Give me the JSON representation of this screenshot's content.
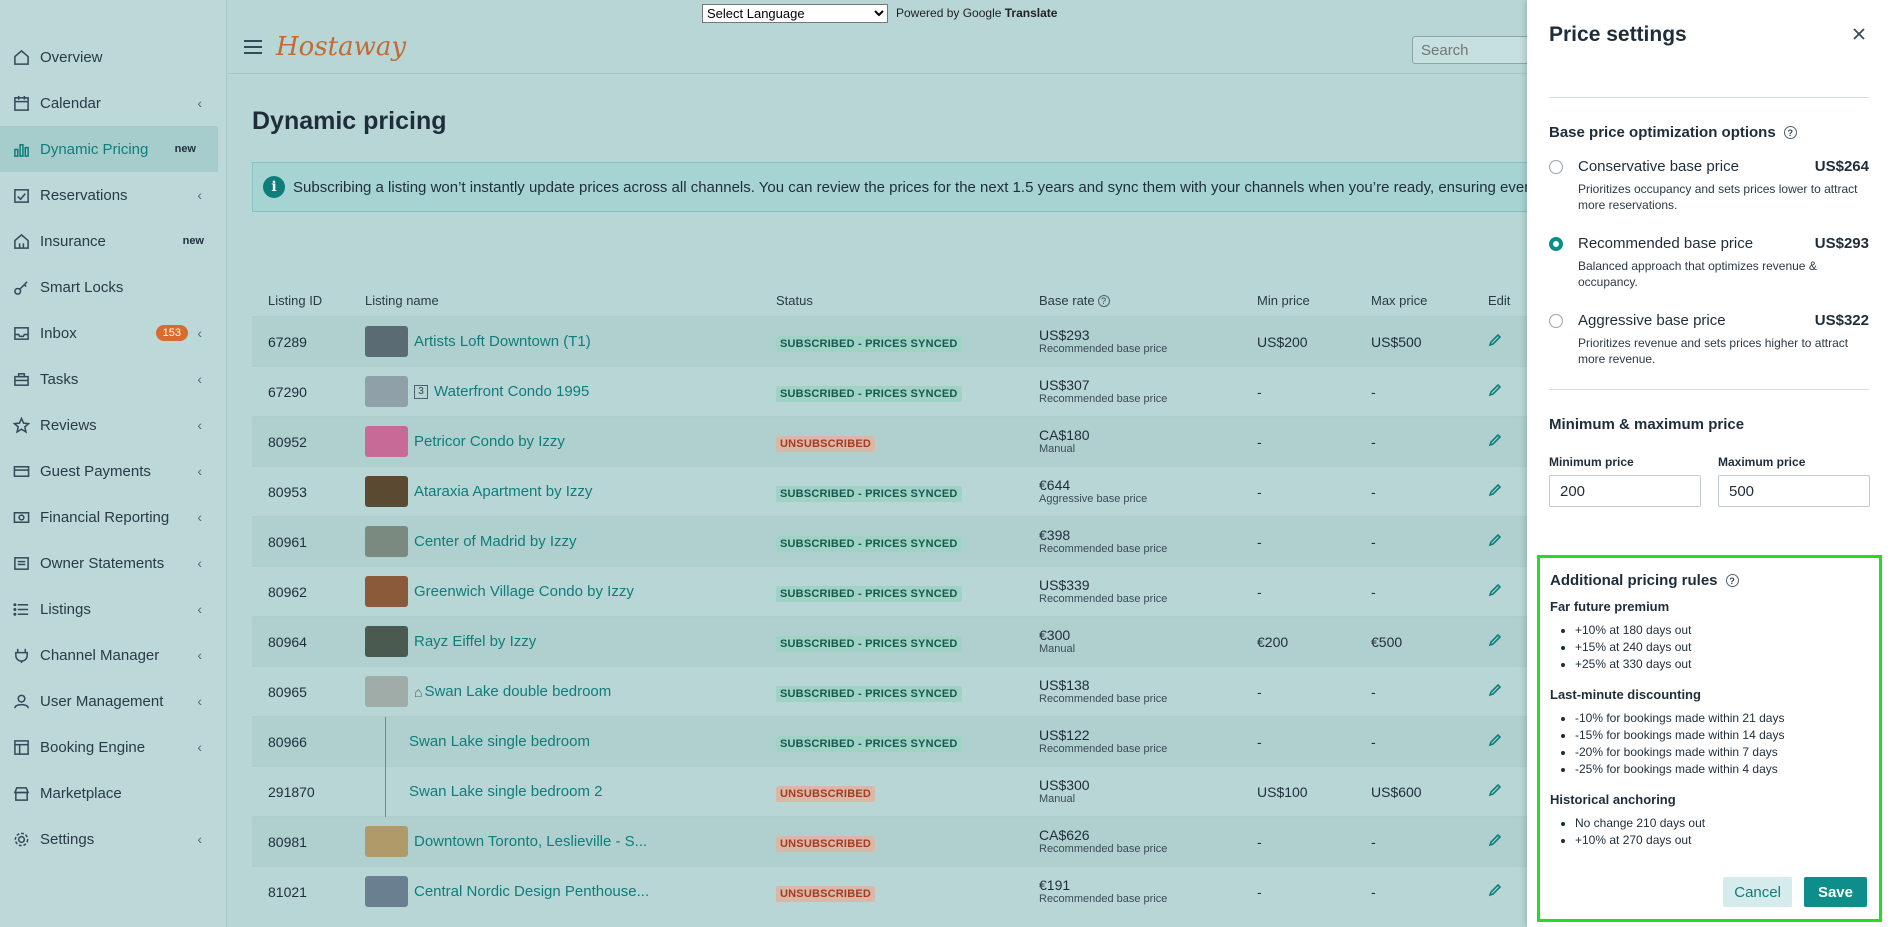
{
  "translate": {
    "select_value": "Select Language",
    "powered_by": "Powered by",
    "google": "Google",
    "translate": "Translate"
  },
  "sidebar": {
    "items": [
      {
        "label": "Overview",
        "icon": "home-icon"
      },
      {
        "label": "Calendar",
        "icon": "calendar-icon",
        "chevron": "‹"
      },
      {
        "label": "Dynamic Pricing",
        "icon": "bar-chart-icon",
        "badge": "new"
      },
      {
        "label": "Reservations",
        "icon": "calendar-check-icon",
        "chevron": "‹"
      },
      {
        "label": "Insurance",
        "icon": "house-shield-icon",
        "badge": "new"
      },
      {
        "label": "Smart Locks",
        "icon": "key-icon"
      },
      {
        "label": "Inbox",
        "icon": "inbox-icon",
        "count": "153",
        "chevron": "‹"
      },
      {
        "label": "Tasks",
        "icon": "toolbox-icon",
        "chevron": "‹"
      },
      {
        "label": "Reviews",
        "icon": "star-icon",
        "chevron": "‹"
      },
      {
        "label": "Guest Payments",
        "icon": "credit-card-icon",
        "chevron": "‹"
      },
      {
        "label": "Financial Reporting",
        "icon": "money-icon",
        "chevron": "‹"
      },
      {
        "label": "Owner Statements",
        "icon": "statement-icon",
        "chevron": "‹"
      },
      {
        "label": "Listings",
        "icon": "list-icon",
        "chevron": "‹"
      },
      {
        "label": "Channel Manager",
        "icon": "plug-icon",
        "chevron": "‹"
      },
      {
        "label": "User Management",
        "icon": "user-icon",
        "chevron": "‹"
      },
      {
        "label": "Booking Engine",
        "icon": "layout-icon",
        "chevron": "‹"
      },
      {
        "label": "Marketplace",
        "icon": "store-icon"
      },
      {
        "label": "Settings",
        "icon": "gear-icon",
        "chevron": "‹"
      }
    ]
  },
  "header": {
    "logo": "Hostaway",
    "search_placeholder": "Search"
  },
  "main": {
    "title": "Dynamic pricing",
    "banner": "Subscribing a listing won’t instantly update prices across all channels. You can review the prices for the next 1.5 years and sync them with your channels when you’re ready, ensuring everythin",
    "columns": {
      "id": "Listing ID",
      "name": "Listing name",
      "status": "Status",
      "base": "Base rate",
      "min": "Min price",
      "max": "Max price",
      "edit": "Edit"
    }
  },
  "rows": [
    {
      "id": "67289",
      "name": "Artists Loft Downtown (T1)",
      "status": "SUBSCRIBED - PRICES SYNCED",
      "sub": true,
      "base": "US$293",
      "base_sub": "Recommended base price",
      "min": "US$200",
      "max": "US$500",
      "thumb": "#5a6b74"
    },
    {
      "id": "67290",
      "name": "Waterfront Condo 1995",
      "unit": "3",
      "status": "SUBSCRIBED - PRICES SYNCED",
      "sub": true,
      "base": "US$307",
      "base_sub": "Recommended base price",
      "min": "-",
      "max": "-",
      "thumb": "#8fa0a8"
    },
    {
      "id": "80952",
      "name": "Petricor Condo by Izzy",
      "status": "UNSUBSCRIBED",
      "sub": false,
      "base": "CA$180",
      "base_sub": "Manual",
      "min": "-",
      "max": "-",
      "thumb": "#c86a98"
    },
    {
      "id": "80953",
      "name": "Ataraxia Apartment by Izzy",
      "status": "SUBSCRIBED - PRICES SYNCED",
      "sub": true,
      "base": "€644",
      "base_sub": "Aggressive base price",
      "min": "-",
      "max": "-",
      "thumb": "#5a4a32"
    },
    {
      "id": "80961",
      "name": "Center of Madrid by Izzy",
      "status": "SUBSCRIBED - PRICES SYNCED",
      "sub": true,
      "base": "€398",
      "base_sub": "Recommended base price",
      "min": "-",
      "max": "-",
      "thumb": "#7a8a80"
    },
    {
      "id": "80962",
      "name": "Greenwich Village Condo by Izzy",
      "status": "SUBSCRIBED - PRICES SYNCED",
      "sub": true,
      "base": "US$339",
      "base_sub": "Recommended base price",
      "min": "-",
      "max": "-",
      "thumb": "#8a5a3a"
    },
    {
      "id": "80964",
      "name": "Rayz Eiffel by Izzy",
      "status": "SUBSCRIBED - PRICES SYNCED",
      "sub": true,
      "base": "€300",
      "base_sub": "Manual",
      "min": "€200",
      "max": "€500",
      "thumb": "#4a5a50"
    },
    {
      "id": "80965",
      "name": "Swan Lake double bedroom",
      "parent": true,
      "status": "SUBSCRIBED - PRICES SYNCED",
      "sub": true,
      "base": "US$138",
      "base_sub": "Recommended base price",
      "min": "-",
      "max": "-",
      "thumb": "#a0aca8"
    },
    {
      "id": "80966",
      "name": "Swan Lake single bedroom",
      "child": true,
      "status": "SUBSCRIBED - PRICES SYNCED",
      "sub": true,
      "base": "US$122",
      "base_sub": "Recommended base price",
      "min": "-",
      "max": "-"
    },
    {
      "id": "291870",
      "name": "Swan Lake single bedroom 2",
      "child": true,
      "status": "UNSUBSCRIBED",
      "sub": false,
      "base": "US$300",
      "base_sub": "Manual",
      "min": "US$100",
      "max": "US$600"
    },
    {
      "id": "80981",
      "name": "Downtown Toronto, Leslieville - S...",
      "status": "UNSUBSCRIBED",
      "sub": false,
      "base": "CA$626",
      "base_sub": "Recommended base price",
      "min": "-",
      "max": "-",
      "thumb": "#b09a6a"
    },
    {
      "id": "81021",
      "name": "Central Nordic Design Penthouse...",
      "status": "UNSUBSCRIBED",
      "sub": false,
      "base": "€191",
      "base_sub": "Recommended base price",
      "min": "-",
      "max": "-",
      "thumb": "#6a8090"
    }
  ],
  "panel": {
    "title": "Price settings",
    "base_section": "Base price optimization options",
    "options": [
      {
        "label": "Conservative base price",
        "price": "US$264",
        "desc": "Prioritizes occupancy and sets prices lower to attract more reservations.",
        "selected": false
      },
      {
        "label": "Recommended base price",
        "price": "US$293",
        "desc": "Balanced approach that optimizes revenue & occupancy.",
        "selected": true
      },
      {
        "label": "Aggressive base price",
        "price": "US$322",
        "desc": "Prioritizes revenue and sets prices higher to attract more revenue.",
        "selected": false
      }
    ],
    "minmax_section": "Minimum & maximum price",
    "min_label": "Minimum price",
    "min_value": "200",
    "max_label": "Maximum price",
    "max_value": "500",
    "rules_section": "Additional pricing rules",
    "far_future": {
      "title": "Far future premium",
      "items": [
        "+10% at 180 days out",
        "+15% at 240 days out",
        "+25% at 330 days out"
      ]
    },
    "last_minute": {
      "title": "Last-minute discounting",
      "items": [
        "-10% for bookings made within 21 days",
        "-15% for bookings made within 14 days",
        "-20% for bookings made within 7 days",
        "-25% for bookings made within 4 days"
      ]
    },
    "historical": {
      "title": "Historical anchoring",
      "items": [
        "No change 210 days out",
        "+10% at 270 days out"
      ]
    },
    "cancel": "Cancel",
    "save": "Save"
  }
}
